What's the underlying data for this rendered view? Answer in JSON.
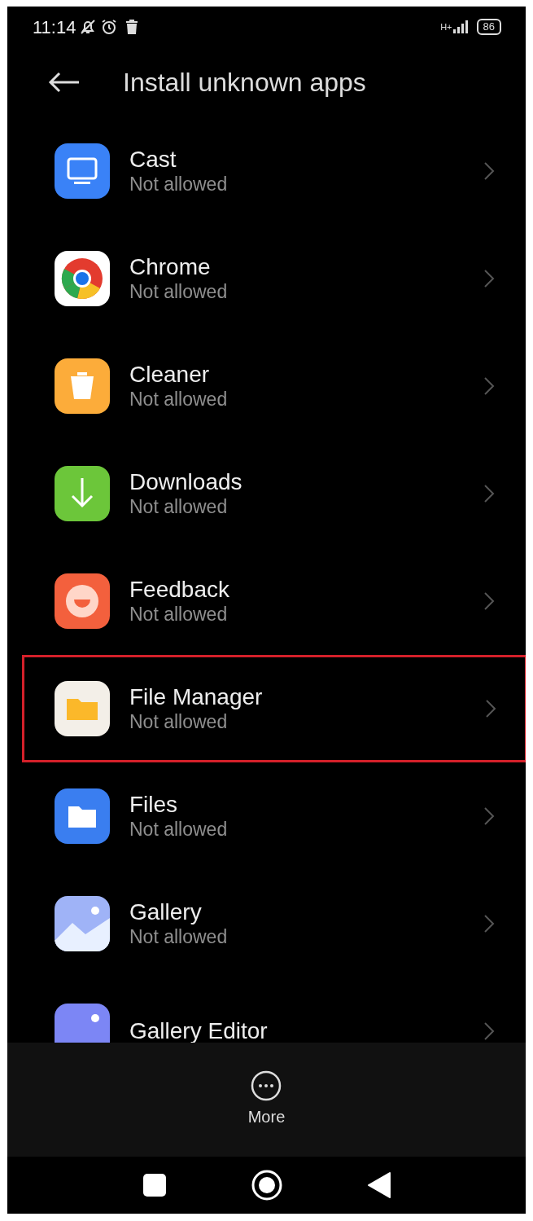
{
  "status_bar": {
    "time": "11:14",
    "network": "H+",
    "battery": "86"
  },
  "header": {
    "title": "Install unknown apps"
  },
  "apps": [
    {
      "name": "Cast",
      "status": "Not allowed",
      "highlighted": false
    },
    {
      "name": "Chrome",
      "status": "Not allowed",
      "highlighted": false
    },
    {
      "name": "Cleaner",
      "status": "Not allowed",
      "highlighted": false
    },
    {
      "name": "Downloads",
      "status": "Not allowed",
      "highlighted": false
    },
    {
      "name": "Feedback",
      "status": "Not allowed",
      "highlighted": false
    },
    {
      "name": "File Manager",
      "status": "Not allowed",
      "highlighted": true
    },
    {
      "name": "Files",
      "status": "Not allowed",
      "highlighted": false
    },
    {
      "name": "Gallery",
      "status": "Not allowed",
      "highlighted": false
    },
    {
      "name": "Gallery Editor",
      "highlighted": false
    }
  ],
  "bottom_bar": {
    "label": "More"
  }
}
